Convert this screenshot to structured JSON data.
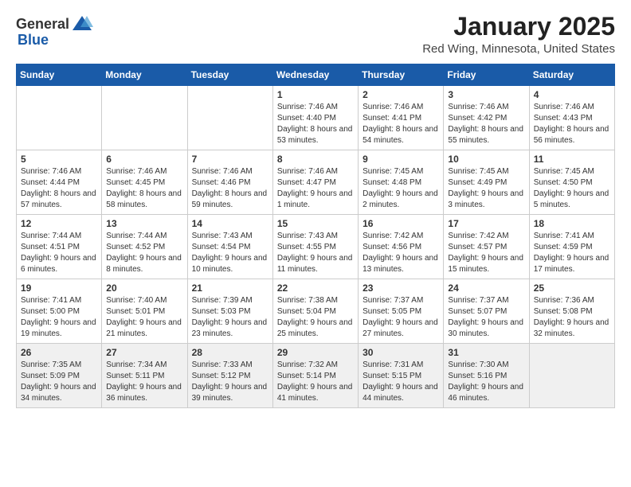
{
  "header": {
    "logo_general": "General",
    "logo_blue": "Blue",
    "month": "January 2025",
    "location": "Red Wing, Minnesota, United States"
  },
  "weekdays": [
    "Sunday",
    "Monday",
    "Tuesday",
    "Wednesday",
    "Thursday",
    "Friday",
    "Saturday"
  ],
  "weeks": [
    [
      {
        "day": "",
        "info": ""
      },
      {
        "day": "",
        "info": ""
      },
      {
        "day": "",
        "info": ""
      },
      {
        "day": "1",
        "info": "Sunrise: 7:46 AM\nSunset: 4:40 PM\nDaylight: 8 hours\nand 53 minutes."
      },
      {
        "day": "2",
        "info": "Sunrise: 7:46 AM\nSunset: 4:41 PM\nDaylight: 8 hours\nand 54 minutes."
      },
      {
        "day": "3",
        "info": "Sunrise: 7:46 AM\nSunset: 4:42 PM\nDaylight: 8 hours\nand 55 minutes."
      },
      {
        "day": "4",
        "info": "Sunrise: 7:46 AM\nSunset: 4:43 PM\nDaylight: 8 hours\nand 56 minutes."
      }
    ],
    [
      {
        "day": "5",
        "info": "Sunrise: 7:46 AM\nSunset: 4:44 PM\nDaylight: 8 hours\nand 57 minutes."
      },
      {
        "day": "6",
        "info": "Sunrise: 7:46 AM\nSunset: 4:45 PM\nDaylight: 8 hours\nand 58 minutes."
      },
      {
        "day": "7",
        "info": "Sunrise: 7:46 AM\nSunset: 4:46 PM\nDaylight: 8 hours\nand 59 minutes."
      },
      {
        "day": "8",
        "info": "Sunrise: 7:46 AM\nSunset: 4:47 PM\nDaylight: 9 hours\nand 1 minute."
      },
      {
        "day": "9",
        "info": "Sunrise: 7:45 AM\nSunset: 4:48 PM\nDaylight: 9 hours\nand 2 minutes."
      },
      {
        "day": "10",
        "info": "Sunrise: 7:45 AM\nSunset: 4:49 PM\nDaylight: 9 hours\nand 3 minutes."
      },
      {
        "day": "11",
        "info": "Sunrise: 7:45 AM\nSunset: 4:50 PM\nDaylight: 9 hours\nand 5 minutes."
      }
    ],
    [
      {
        "day": "12",
        "info": "Sunrise: 7:44 AM\nSunset: 4:51 PM\nDaylight: 9 hours\nand 6 minutes."
      },
      {
        "day": "13",
        "info": "Sunrise: 7:44 AM\nSunset: 4:52 PM\nDaylight: 9 hours\nand 8 minutes."
      },
      {
        "day": "14",
        "info": "Sunrise: 7:43 AM\nSunset: 4:54 PM\nDaylight: 9 hours\nand 10 minutes."
      },
      {
        "day": "15",
        "info": "Sunrise: 7:43 AM\nSunset: 4:55 PM\nDaylight: 9 hours\nand 11 minutes."
      },
      {
        "day": "16",
        "info": "Sunrise: 7:42 AM\nSunset: 4:56 PM\nDaylight: 9 hours\nand 13 minutes."
      },
      {
        "day": "17",
        "info": "Sunrise: 7:42 AM\nSunset: 4:57 PM\nDaylight: 9 hours\nand 15 minutes."
      },
      {
        "day": "18",
        "info": "Sunrise: 7:41 AM\nSunset: 4:59 PM\nDaylight: 9 hours\nand 17 minutes."
      }
    ],
    [
      {
        "day": "19",
        "info": "Sunrise: 7:41 AM\nSunset: 5:00 PM\nDaylight: 9 hours\nand 19 minutes."
      },
      {
        "day": "20",
        "info": "Sunrise: 7:40 AM\nSunset: 5:01 PM\nDaylight: 9 hours\nand 21 minutes."
      },
      {
        "day": "21",
        "info": "Sunrise: 7:39 AM\nSunset: 5:03 PM\nDaylight: 9 hours\nand 23 minutes."
      },
      {
        "day": "22",
        "info": "Sunrise: 7:38 AM\nSunset: 5:04 PM\nDaylight: 9 hours\nand 25 minutes."
      },
      {
        "day": "23",
        "info": "Sunrise: 7:37 AM\nSunset: 5:05 PM\nDaylight: 9 hours\nand 27 minutes."
      },
      {
        "day": "24",
        "info": "Sunrise: 7:37 AM\nSunset: 5:07 PM\nDaylight: 9 hours\nand 30 minutes."
      },
      {
        "day": "25",
        "info": "Sunrise: 7:36 AM\nSunset: 5:08 PM\nDaylight: 9 hours\nand 32 minutes."
      }
    ],
    [
      {
        "day": "26",
        "info": "Sunrise: 7:35 AM\nSunset: 5:09 PM\nDaylight: 9 hours\nand 34 minutes."
      },
      {
        "day": "27",
        "info": "Sunrise: 7:34 AM\nSunset: 5:11 PM\nDaylight: 9 hours\nand 36 minutes."
      },
      {
        "day": "28",
        "info": "Sunrise: 7:33 AM\nSunset: 5:12 PM\nDaylight: 9 hours\nand 39 minutes."
      },
      {
        "day": "29",
        "info": "Sunrise: 7:32 AM\nSunset: 5:14 PM\nDaylight: 9 hours\nand 41 minutes."
      },
      {
        "day": "30",
        "info": "Sunrise: 7:31 AM\nSunset: 5:15 PM\nDaylight: 9 hours\nand 44 minutes."
      },
      {
        "day": "31",
        "info": "Sunrise: 7:30 AM\nSunset: 5:16 PM\nDaylight: 9 hours\nand 46 minutes."
      },
      {
        "day": "",
        "info": ""
      }
    ]
  ]
}
